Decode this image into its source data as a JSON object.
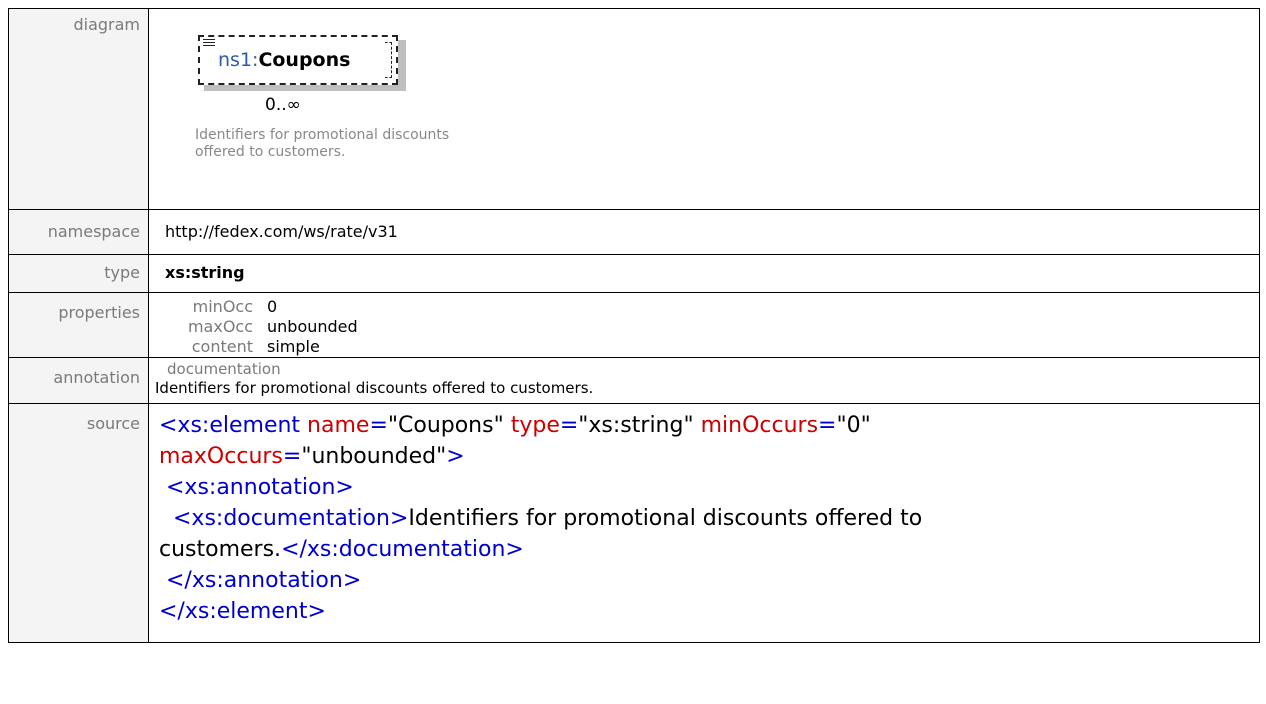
{
  "labels": {
    "diagram": "diagram",
    "namespace": "namespace",
    "type": "type",
    "properties": "properties",
    "annotation": "annotation",
    "source": "source"
  },
  "diagram": {
    "prefix": "ns1:",
    "element_name": "Coupons",
    "cardinality": "0..∞",
    "note": "Identifiers for promotional discounts offered to customers."
  },
  "namespace": "http://fedex.com/ws/rate/v31",
  "type": "xs:string",
  "properties": [
    {
      "key": "minOcc",
      "value": "0"
    },
    {
      "key": "maxOcc",
      "value": "unbounded"
    },
    {
      "key": "content",
      "value": "simple"
    }
  ],
  "annotation": {
    "heading": "documentation",
    "text": "Identifiers for promotional discounts offered to customers."
  },
  "source": {
    "l1_tag": "<xs:element",
    "l1_a1": " name",
    "l1_a1v": "\"Coupons\"",
    "l1_a2": " type",
    "l1_a2v": "\"xs:string\"",
    "l1_a3": " minOccurs",
    "l1_a3v": "\"0\"",
    "l2_a4": "maxOccurs",
    "l2_a4v": "\"unbounded\"",
    "l2_close": ">",
    "l3": " <xs:annotation>",
    "l4_open": "  <xs:documentation>",
    "l4_text": "Identifiers for promotional discounts offered to",
    "l5_text": "customers.",
    "l5_close": "</xs:documentation>",
    "l6": " </xs:annotation>",
    "l7": "</xs:element>",
    "eq": "="
  }
}
